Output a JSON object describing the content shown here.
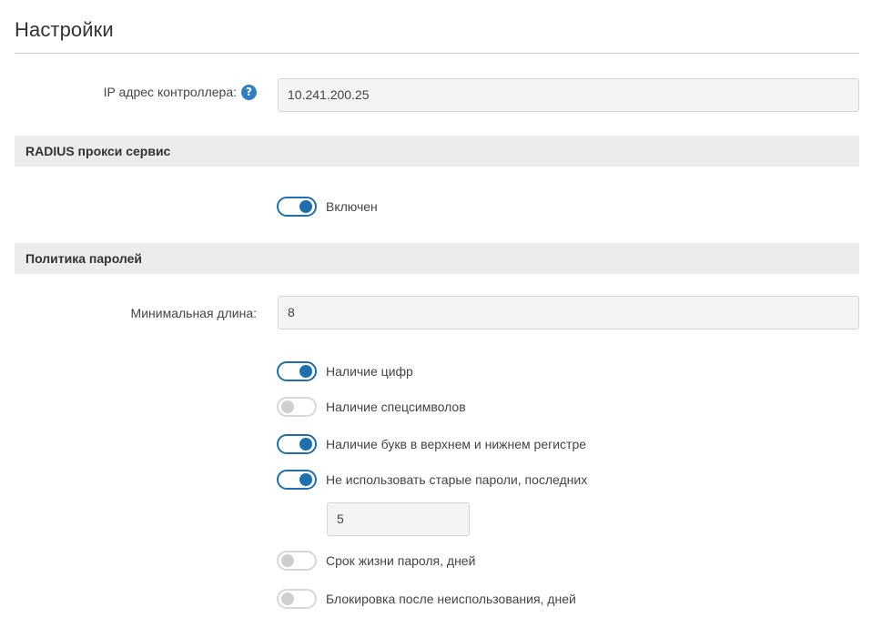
{
  "page": {
    "title": "Настройки"
  },
  "controller": {
    "ip_label": "IP адрес контроллера:",
    "ip_value": "10.241.200.25",
    "help_icon": "question-circle-icon"
  },
  "radius": {
    "header": "RADIUS прокси сервис",
    "enabled_label": "Включен",
    "enabled": true
  },
  "password_policy": {
    "header": "Политика паролей",
    "min_length_label": "Минимальная длина:",
    "min_length_value": "8",
    "options": [
      {
        "label": "Наличие цифр",
        "enabled": true
      },
      {
        "label": "Наличие спецсимволов",
        "enabled": false
      },
      {
        "label": "Наличие букв в верхнем и нижнем регистре",
        "enabled": true
      },
      {
        "label": "Не использовать старые пароли, последних",
        "enabled": true
      },
      {
        "label": "Срок жизни пароля, дней",
        "enabled": false
      },
      {
        "label": "Блокировка после неиспользования, дней",
        "enabled": false
      }
    ],
    "old_passwords_count": "5"
  },
  "colors": {
    "accent": "#1f6fb0",
    "help_icon": "#2f7fc1",
    "section_bg": "#ececec",
    "toggle_off": "#cfcfcf"
  }
}
